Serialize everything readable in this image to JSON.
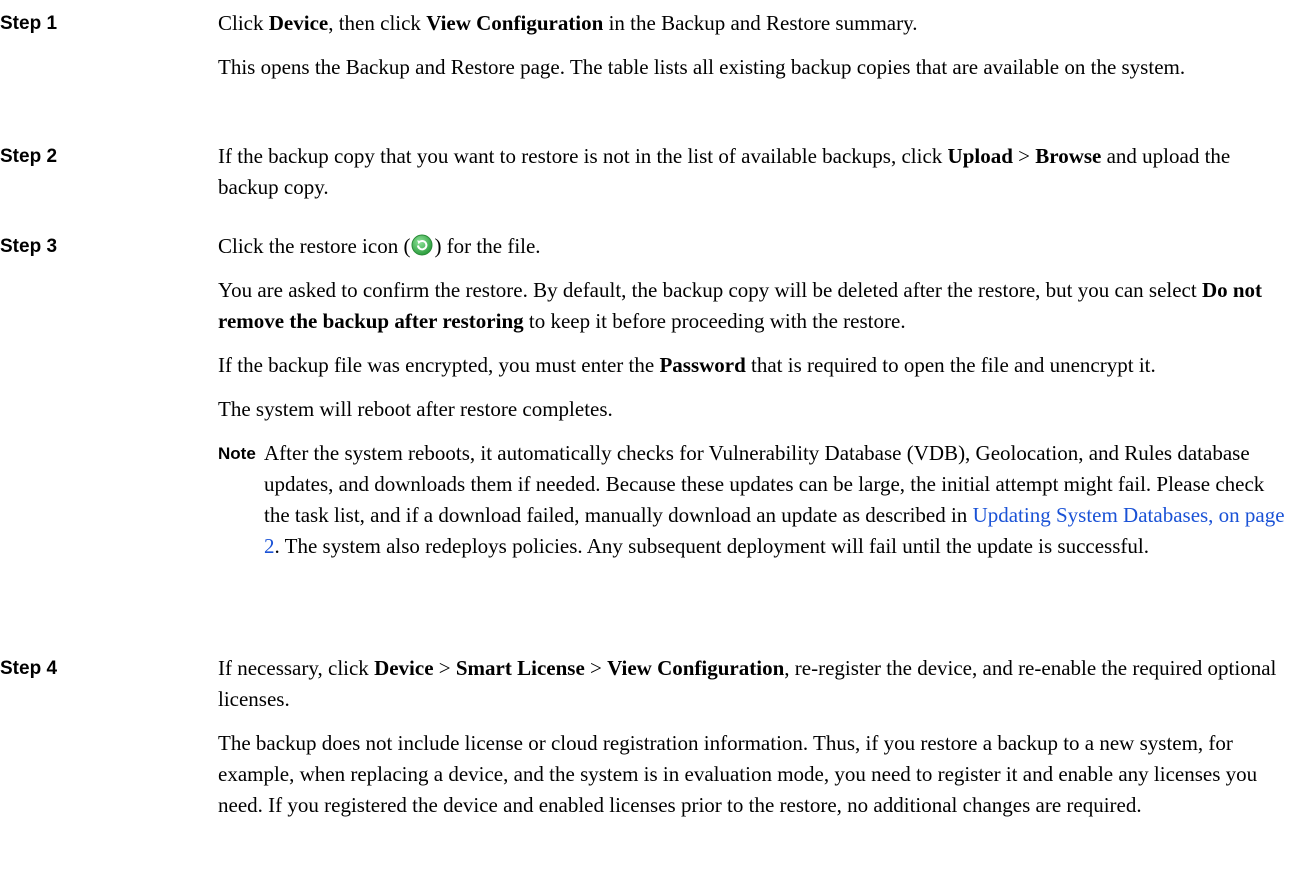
{
  "steps": [
    {
      "label": "Step 1",
      "p1": {
        "t1": "Click ",
        "b1": "Device",
        "t2": ", then click ",
        "b2": "View Configuration",
        "t3": " in the Backup and Restore summary."
      },
      "p2": "This opens the Backup and Restore page. The table lists all existing backup copies that are available on the system."
    },
    {
      "label": "Step 2",
      "p1": {
        "t1": "If the backup copy that you want to restore is not in the list of available backups, click ",
        "b1": "Upload",
        "t2": " > ",
        "b2": "Browse",
        "t3": " and upload the backup copy."
      }
    },
    {
      "label": "Step 3",
      "p1": {
        "t1": "Click the restore icon (",
        "icon": "restore-icon",
        "t2": ") for the file."
      },
      "p2": {
        "t1": "You are asked to confirm the restore. By default, the backup copy will be deleted after the restore, but you can select ",
        "b1": "Do not remove the backup after restoring",
        "t2": " to keep it before proceeding with the restore."
      },
      "p3": {
        "t1": "If the backup file was encrypted, you must enter the ",
        "b1": "Password",
        "t2": " that is required to open the file and unencrypt it."
      },
      "p4": "The system will reboot after restore completes.",
      "note": {
        "label": "Note",
        "t1": "After the system reboots, it automatically checks for Vulnerability Database (VDB), Geolocation, and Rules database updates, and downloads them if needed. Because these updates can be large, the initial attempt might fail. Please check the task list, and if a download failed, manually download an update as described in ",
        "link": "Updating System Databases, on page 2",
        "t2": ". The system also redeploys policies. Any subsequent deployment will fail until the update is successful."
      }
    },
    {
      "label": "Step 4",
      "p1": {
        "t1": "If necessary, click ",
        "b1": "Device",
        "t2": " > ",
        "b2": "Smart License",
        "t3": " > ",
        "b3": "View Configuration",
        "t4": ", re-register the device, and re-enable the required optional licenses."
      },
      "p2": "The backup does not include license or cloud registration information. Thus, if you restore a backup to a new system, for example, when replacing a device, and the system is in evaluation mode, you need to register it and enable any licenses you need. If you registered the device and enabled licenses prior to the restore, no additional changes are required."
    }
  ],
  "colors": {
    "link": "#1a52d6",
    "icon_green": "#3fb34f"
  }
}
